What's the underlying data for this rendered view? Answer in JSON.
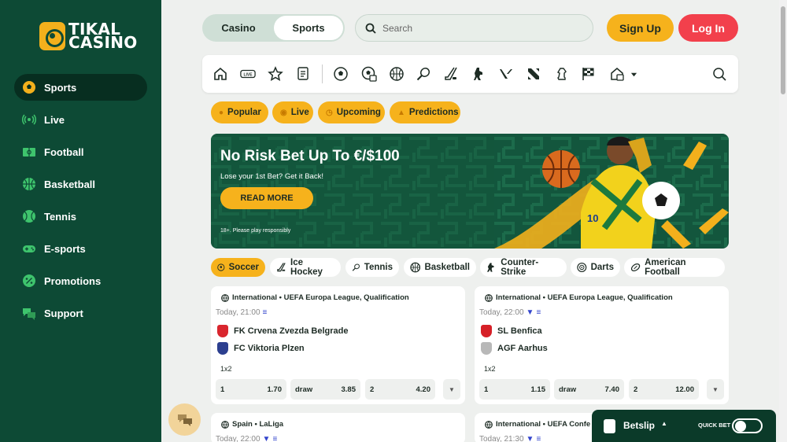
{
  "brand": {
    "line1": "TIKAL",
    "line2": "CASINO",
    "accent": "#f3b01c",
    "sidebar_bg": "#0d4a35"
  },
  "sidebar": {
    "items": [
      {
        "label": "Sports",
        "icon": "soccer-ball-icon",
        "active": true
      },
      {
        "label": "Live",
        "icon": "live-signal-icon"
      },
      {
        "label": "Football",
        "icon": "football-field-icon"
      },
      {
        "label": "Basketball",
        "icon": "basketball-icon"
      },
      {
        "label": "Tennis",
        "icon": "tennis-ball-icon"
      },
      {
        "label": "E-sports",
        "icon": "gamepad-icon"
      },
      {
        "label": "Promotions",
        "icon": "percent-badge-icon"
      },
      {
        "label": "Support",
        "icon": "chat-bubbles-icon"
      }
    ]
  },
  "header": {
    "mode": {
      "casino": "Casino",
      "sports": "Sports",
      "selected": "Sports"
    },
    "search": {
      "placeholder": "Search"
    },
    "signup": "Sign Up",
    "login": "Log In"
  },
  "sport_icons": [
    "home-icon",
    "live-tv-icon",
    "star-icon",
    "betslip-list-icon",
    "soccer-icon",
    "virtual-soccer-icon",
    "basketball-icon",
    "tennis-icon",
    "hockey-icon",
    "counter-strike-icon",
    "valorant-icon",
    "dota-icon",
    "chess-icon",
    "racing-flag-icon",
    "more-sports-icon",
    "dropdown-caret-icon",
    "search-icon"
  ],
  "filters": [
    {
      "label": "Popular",
      "icon": "fire-icon"
    },
    {
      "label": "Live",
      "icon": "live-signal-icon"
    },
    {
      "label": "Upcoming",
      "icon": "clock-icon"
    },
    {
      "label": "Predictions",
      "icon": "chart-icon"
    }
  ],
  "banner": {
    "title": "No Risk Bet Up To €/$100",
    "subtitle": "Lose your 1st Bet? Get it Back!",
    "cta": "READ MORE",
    "disclaimer": "18+. Please play responsibly",
    "player_number": "10"
  },
  "sport_tabs": [
    {
      "label": "Soccer",
      "active": true
    },
    {
      "label": "Ice Hockey"
    },
    {
      "label": "Tennis"
    },
    {
      "label": "Basketball"
    },
    {
      "label": "Counter-Strike"
    },
    {
      "label": "Darts"
    },
    {
      "label": "American Football"
    }
  ],
  "matches": [
    {
      "league": "International • UEFA Europa League, Qualification",
      "time": "Today, 21:00",
      "home": "FK Crvena Zvezda Belgrade",
      "away": "FC Viktoria Plzen",
      "home_color": "#d9262e",
      "away_color": "#2c3f8f",
      "market": "1x2",
      "odds": [
        {
          "label": "1",
          "value": "1.70"
        },
        {
          "label": "draw",
          "value": "3.85"
        },
        {
          "label": "2",
          "value": "4.20"
        }
      ]
    },
    {
      "league": "International • UEFA Europa League, Qualification",
      "time": "Today, 22:00",
      "home": "SL Benfica",
      "away": "AGF Aarhus",
      "home_color": "#d62027",
      "away_color": "#b8b8b8",
      "market": "1x2",
      "odds": [
        {
          "label": "1",
          "value": "1.15"
        },
        {
          "label": "draw",
          "value": "7.40"
        },
        {
          "label": "2",
          "value": "12.00"
        }
      ]
    },
    {
      "league": "Spain • LaLiga",
      "time": "Today, 22:00"
    },
    {
      "league": "International • UEFA Confe",
      "time": "Today, 21:30"
    }
  ],
  "betslip": {
    "label": "Betslip",
    "quickbet": "QUICK BET"
  }
}
